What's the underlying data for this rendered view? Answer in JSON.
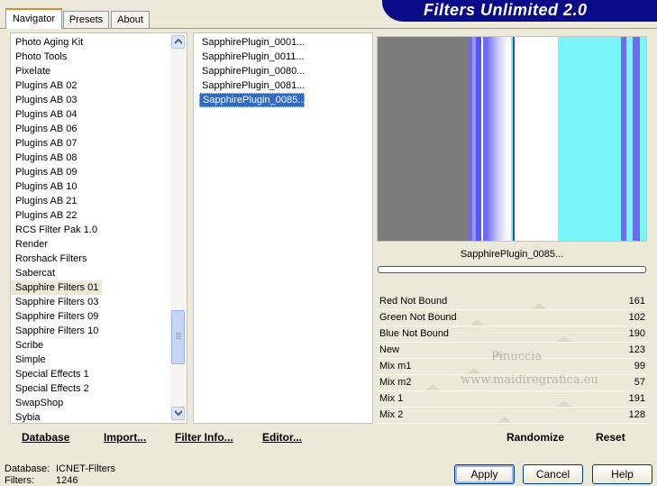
{
  "tabs": [
    {
      "label": "Navigator"
    },
    {
      "label": "Presets"
    },
    {
      "label": "About"
    }
  ],
  "banner": {
    "title": "Filters Unlimited 2.0"
  },
  "categories": [
    "Photo Aging Kit",
    "Photo Tools",
    "Pixelate",
    "Plugins AB 02",
    "Plugins AB 03",
    "Plugins AB 04",
    "Plugins AB 06",
    "Plugins AB 07",
    "Plugins AB 08",
    "Plugins AB 09",
    "Plugins AB 10",
    "Plugins AB 21",
    "Plugins AB 22",
    "RCS Filter Pak 1.0",
    "Render",
    "Rorshack Filters",
    "Sabercat",
    "Sapphire Filters 01",
    "Sapphire Filters 03",
    "Sapphire Filters 09",
    "Sapphire Filters 10",
    "Scribe",
    "Simple",
    "Special Effects 1",
    "Special Effects 2",
    "SwapShop",
    "Sybia"
  ],
  "selected_category": "Sapphire Filters 01",
  "filters": [
    "SapphirePlugin_0001...",
    "SapphirePlugin_0011...",
    "SapphirePlugin_0080...",
    "SapphirePlugin_0081...",
    "SapphirePlugin_0085..."
  ],
  "selected_filter": "SapphirePlugin_0085...",
  "preview": {
    "filter_name": "SapphirePlugin_0085...",
    "colors": {
      "grey": "#7c7c7c",
      "cyan": "#7af5f8",
      "blue": "#6c6cf0",
      "white": "#ffffff"
    }
  },
  "params": [
    {
      "label": "Red Not Bound",
      "value": "161"
    },
    {
      "label": "Green Not Bound",
      "value": "102"
    },
    {
      "label": "Blue Not Bound",
      "value": "190"
    },
    {
      "label": "New",
      "value": "123"
    },
    {
      "label": "Mix m1",
      "value": "99"
    },
    {
      "label": "Mix m2",
      "value": "57"
    },
    {
      "label": "Mix 1",
      "value": "191"
    },
    {
      "label": "Mix 2",
      "value": "128"
    }
  ],
  "toolbar": {
    "database": "Database",
    "import": "Import...",
    "filter_info": "Filter Info...",
    "editor": "Editor...",
    "randomize": "Randomize",
    "reset": "Reset"
  },
  "status": {
    "database_label": "Database:",
    "database_value": "ICNET-Filters",
    "filters_label": "Filters:",
    "filters_value": "1246"
  },
  "buttons": {
    "apply": "Apply",
    "cancel": "Cancel",
    "help": "Help"
  },
  "watermark": {
    "line1": "Pinuccia",
    "line2": "www.maidiregrafica.eu"
  }
}
